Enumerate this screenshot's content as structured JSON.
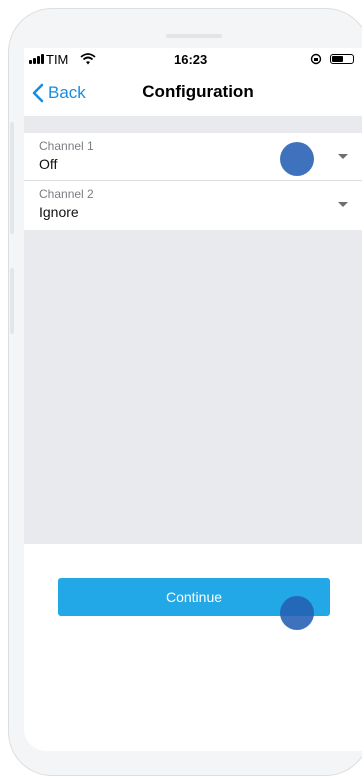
{
  "status_bar": {
    "carrier": "TIM",
    "time": "16:23",
    "icons": [
      "signal-icon",
      "wifi-icon",
      "rotation-lock-icon",
      "battery-icon"
    ]
  },
  "nav": {
    "back_label": "Back",
    "title": "Configuration"
  },
  "channels": [
    {
      "label": "Channel 1",
      "value": "Off"
    },
    {
      "label": "Channel 2",
      "value": "Ignore"
    }
  ],
  "continue_label": "Continue",
  "colors": {
    "accent": "#1a8de0",
    "button": "#22a8e6",
    "content_background": "#e8eaed",
    "touch_marker": "#245fb4"
  }
}
